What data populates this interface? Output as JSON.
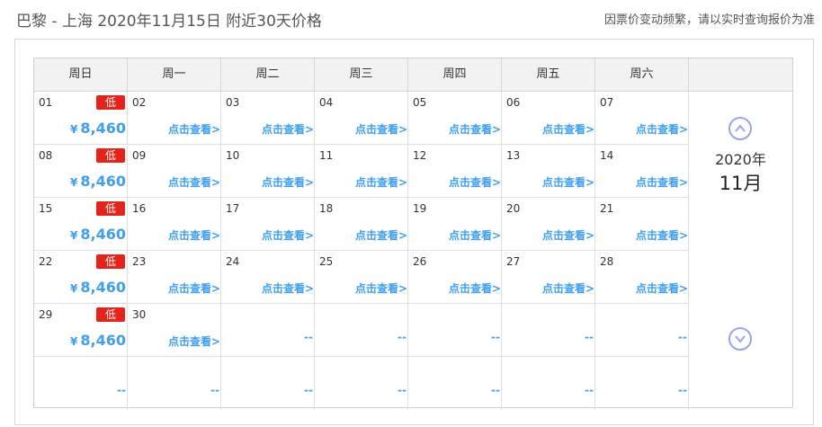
{
  "header": {
    "title": "巴黎 - 上海 2020年11月15日  附近30天价格",
    "notice": "因票价变动频繁，请以实时查询报价为准"
  },
  "weekdays": [
    "周日",
    "周一",
    "周二",
    "周三",
    "周四",
    "周五",
    "周六"
  ],
  "side": {
    "year": "2020年",
    "month": "11月"
  },
  "labels": {
    "view": "点击查看>",
    "low": "低",
    "currency": "¥",
    "empty": "--"
  },
  "weeks": [
    [
      {
        "day": "01",
        "price": "8,460",
        "low": true
      },
      {
        "day": "02"
      },
      {
        "day": "03"
      },
      {
        "day": "04"
      },
      {
        "day": "05"
      },
      {
        "day": "06"
      },
      {
        "day": "07"
      }
    ],
    [
      {
        "day": "08",
        "price": "8,460",
        "low": true
      },
      {
        "day": "09"
      },
      {
        "day": "10"
      },
      {
        "day": "11"
      },
      {
        "day": "12"
      },
      {
        "day": "13"
      },
      {
        "day": "14"
      }
    ],
    [
      {
        "day": "15",
        "price": "8,460",
        "low": true
      },
      {
        "day": "16"
      },
      {
        "day": "17"
      },
      {
        "day": "18"
      },
      {
        "day": "19"
      },
      {
        "day": "20"
      },
      {
        "day": "21"
      }
    ],
    [
      {
        "day": "22",
        "price": "8,460",
        "low": true
      },
      {
        "day": "23"
      },
      {
        "day": "24"
      },
      {
        "day": "25"
      },
      {
        "day": "26"
      },
      {
        "day": "27"
      },
      {
        "day": "28"
      }
    ],
    [
      {
        "day": "29",
        "price": "8,460",
        "low": true
      },
      {
        "day": "30"
      },
      {
        "empty": true
      },
      {
        "empty": true
      },
      {
        "empty": true
      },
      {
        "empty": true
      },
      {
        "empty": true
      }
    ],
    [
      {
        "empty": true
      },
      {
        "empty": true
      },
      {
        "empty": true
      },
      {
        "empty": true
      },
      {
        "empty": true
      },
      {
        "empty": true
      },
      {
        "empty": true
      }
    ]
  ]
}
